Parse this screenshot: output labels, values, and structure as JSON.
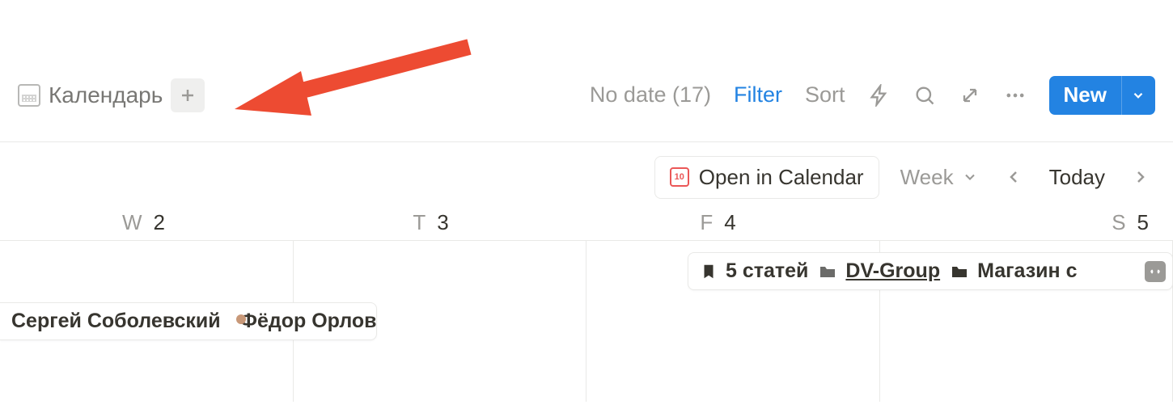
{
  "view": {
    "tab_label": "Календарь",
    "no_date_label": "No date (17)",
    "filter_label": "Filter",
    "sort_label": "Sort",
    "new_button": "New"
  },
  "subtoolbar": {
    "open_in_calendar": "Open in Calendar",
    "open_cal_daynum": "10",
    "range_label": "Week",
    "today_label": "Today"
  },
  "days": [
    {
      "letter": "W",
      "num": "2"
    },
    {
      "letter": "T",
      "num": "3"
    },
    {
      "letter": "F",
      "num": "4"
    },
    {
      "letter": "S",
      "num": "5"
    }
  ],
  "events": {
    "e1": {
      "person1": "Сергей Соболевский",
      "person2": "Фёдор Орлов"
    },
    "e2": {
      "tag1": "5 статей",
      "tag2": "DV-Group",
      "tag3": "Магазин с"
    }
  },
  "colors": {
    "accent": "#2383e2",
    "annotation": "#ed4b32"
  }
}
